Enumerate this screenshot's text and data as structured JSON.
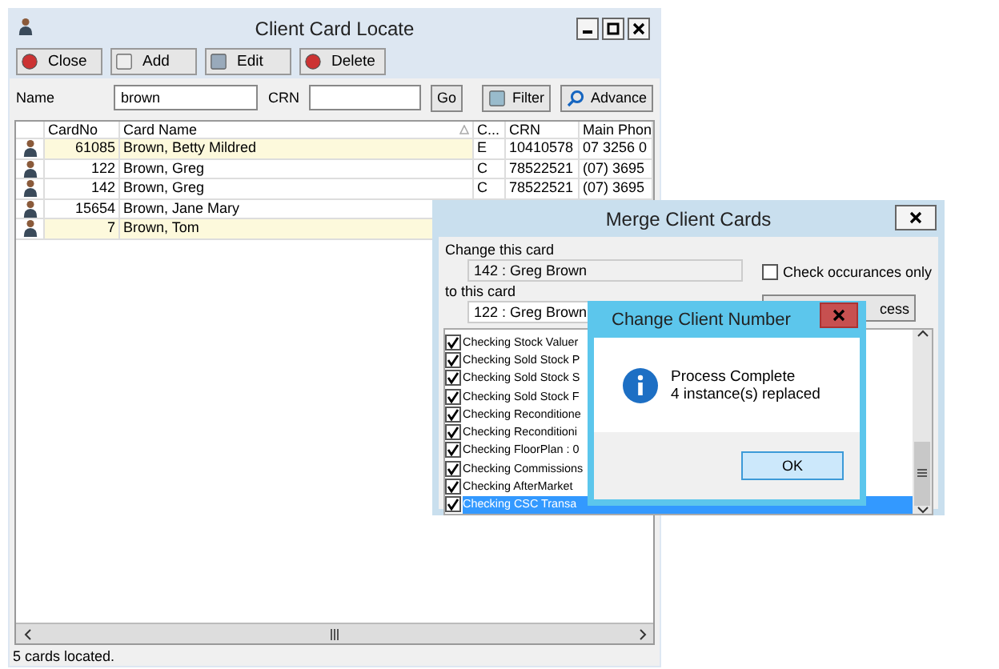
{
  "main_window": {
    "title": "Client Card Locate",
    "toolbar": [
      "Close",
      "Add",
      "Edit",
      "Delete"
    ],
    "search": {
      "name_label": "Name",
      "name_value": "brown",
      "crn_label": "CRN",
      "go": "Go",
      "filter": "Filter",
      "advanced": "Advance"
    },
    "table": {
      "columns": [
        "CardNo",
        "Card Name",
        "C...",
        "CRN",
        "Main Phon"
      ],
      "rows": [
        {
          "cells": [
            "61085",
            "Brown, Betty Mildred",
            "E",
            "10410578",
            "07 3256 0"
          ],
          "highlighted": true
        },
        {
          "cells": [
            "122",
            "Brown, Greg",
            "C",
            "78522521",
            "(07) 3695"
          ],
          "highlighted": false
        },
        {
          "cells": [
            "142",
            "Brown, Greg",
            "C",
            "78522521",
            "(07) 3695"
          ],
          "highlighted": false
        },
        {
          "cells": [
            "15654",
            "Brown, Jane Mary"
          ],
          "highlighted": false
        },
        {
          "cells": [
            "7",
            "Brown, Tom"
          ],
          "highlighted": true
        }
      ]
    },
    "status_bar": "5 cards located."
  },
  "merge_dialog": {
    "title": "Merge Client Cards",
    "change_label": "Change this card",
    "change_value": "142 : Greg Brown",
    "to_label": "to this card",
    "to_value": "122 : Greg Brown",
    "check_only": {
      "label": "Check occurances only",
      "checked": false
    },
    "process_button": "cess",
    "items": [
      {
        "label": "Checking Stock Valuer",
        "checked": true,
        "selected": false
      },
      {
        "label": "Checking Sold Stock P",
        "checked": true,
        "selected": false
      },
      {
        "label": "Checking Sold Stock S",
        "checked": true,
        "selected": false
      },
      {
        "label": "Checking Sold Stock F",
        "checked": true,
        "selected": false
      },
      {
        "label": "Checking Reconditione",
        "checked": true,
        "selected": false
      },
      {
        "label": "Checking Reconditioni",
        "checked": true,
        "selected": false
      },
      {
        "label": "Checking FloorPlan : 0",
        "checked": true,
        "selected": false
      },
      {
        "label": "Checking Commissions",
        "checked": true,
        "selected": false
      },
      {
        "label": "Checking AfterMarket",
        "checked": true,
        "selected": false
      },
      {
        "label": "Checking CSC Transa",
        "checked": true,
        "selected": true
      }
    ]
  },
  "message_box": {
    "title": "Change Client Number",
    "lines": [
      "Process Complete",
      "4 instance(s) replaced"
    ],
    "ok": "OK"
  }
}
